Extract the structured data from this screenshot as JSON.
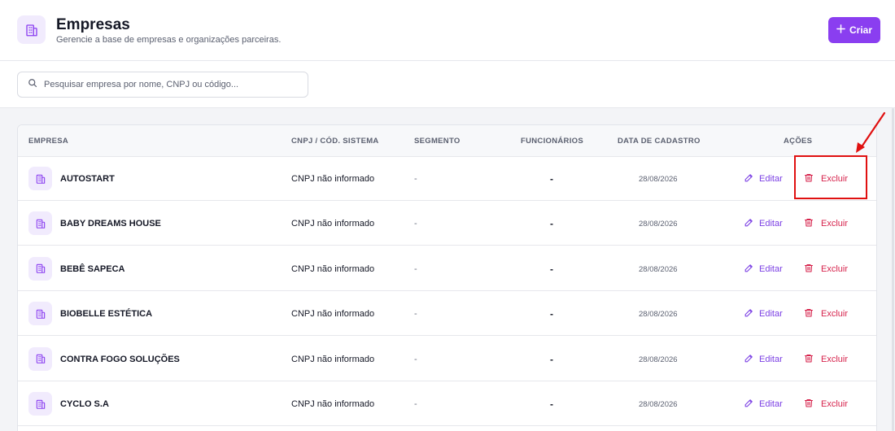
{
  "header": {
    "title": "Empresas",
    "subtitle": "Gerencie a base de empresas e organizações parceiras.",
    "icon": "building-icon",
    "create_button": {
      "icon": "plus-icon",
      "label": "Criar"
    }
  },
  "search": {
    "icon": "search-icon",
    "placeholder": "Pesquisar empresa por nome, CNPJ ou código..."
  },
  "table": {
    "columns": [
      "EMPRESA",
      "CNPJ / CÓD. SISTEMA",
      "SEGMENTO",
      "FUNCIONÁRIOS",
      "DATA DE CADASTRO",
      "AÇÕES"
    ],
    "actions": {
      "edit_label": "Editar",
      "edit_icon": "pencil-icon",
      "delete_label": "Excluir",
      "delete_icon": "trash-icon"
    },
    "rows": [
      {
        "name": "AUTOSTART",
        "cnpj": "CNPJ não informado",
        "segment": "-",
        "employees": "-",
        "date": "28/08/2026"
      },
      {
        "name": "BABY DREAMS HOUSE",
        "cnpj": "CNPJ não informado",
        "segment": "-",
        "employees": "-",
        "date": "28/08/2026"
      },
      {
        "name": "BEBÊ SAPECA",
        "cnpj": "CNPJ não informado",
        "segment": "-",
        "employees": "-",
        "date": "28/08/2026"
      },
      {
        "name": "BIOBELLE ESTÉTICA",
        "cnpj": "CNPJ não informado",
        "segment": "-",
        "employees": "-",
        "date": "28/08/2026"
      },
      {
        "name": "CONTRA FOGO SOLUÇÕES",
        "cnpj": "CNPJ não informado",
        "segment": "-",
        "employees": "-",
        "date": "28/08/2026"
      },
      {
        "name": "CYCLO S.A",
        "cnpj": "CNPJ não informado",
        "segment": "-",
        "employees": "-",
        "date": "28/08/2026"
      }
    ]
  },
  "colors": {
    "accent": "#8a3ef0",
    "edit": "#7b3fe4",
    "delete": "#d6224b",
    "annotation": "#e01010"
  }
}
